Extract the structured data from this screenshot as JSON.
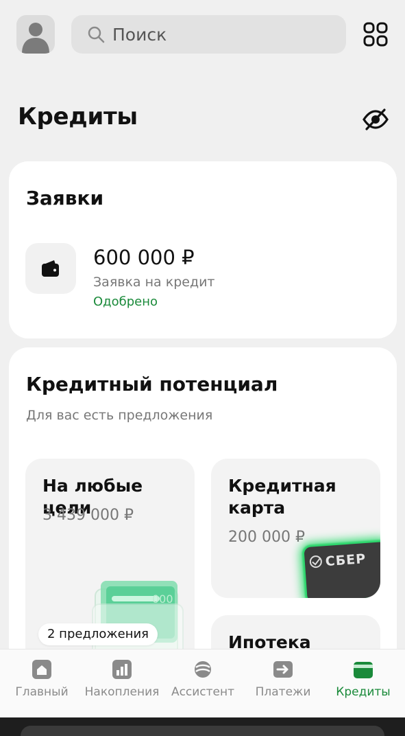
{
  "header": {
    "search_placeholder": "Поиск",
    "avatar_icon": "user-avatar-icon",
    "apps_icon": "apps-grid-icon"
  },
  "page": {
    "title": "Кредиты",
    "visibility_icon": "eye-off-icon"
  },
  "applications": {
    "title": "Заявки",
    "items": [
      {
        "amount": "600 000 ₽",
        "description": "Заявка на кредит",
        "status": "Одобрено",
        "icon": "wallet-icon"
      }
    ]
  },
  "potential": {
    "title": "Кредитный потенциал",
    "subtitle": "Для вас есть предложения",
    "offers": [
      {
        "title": "На любые цели",
        "amount": "3 439 000 ₽",
        "badge": "2 предложения"
      },
      {
        "title": "Кредитная карта",
        "amount": "200 000 ₽",
        "card_brand": "СБЕР"
      },
      {
        "title": "Ипотека"
      }
    ]
  },
  "nav": {
    "tabs": [
      {
        "label": "Главный",
        "icon": "home-icon",
        "active": false
      },
      {
        "label": "Накопления",
        "icon": "chart-icon",
        "active": false
      },
      {
        "label": "Ассистент",
        "icon": "assistant-icon",
        "active": false
      },
      {
        "label": "Платежи",
        "icon": "arrow-right-icon",
        "active": false
      },
      {
        "label": "Кредиты",
        "icon": "wallet-icon",
        "active": true
      }
    ]
  },
  "colors": {
    "accent_green": "#1a8a3a",
    "background": "#f0f0f0",
    "card": "#ffffff",
    "muted_text": "#777777"
  }
}
